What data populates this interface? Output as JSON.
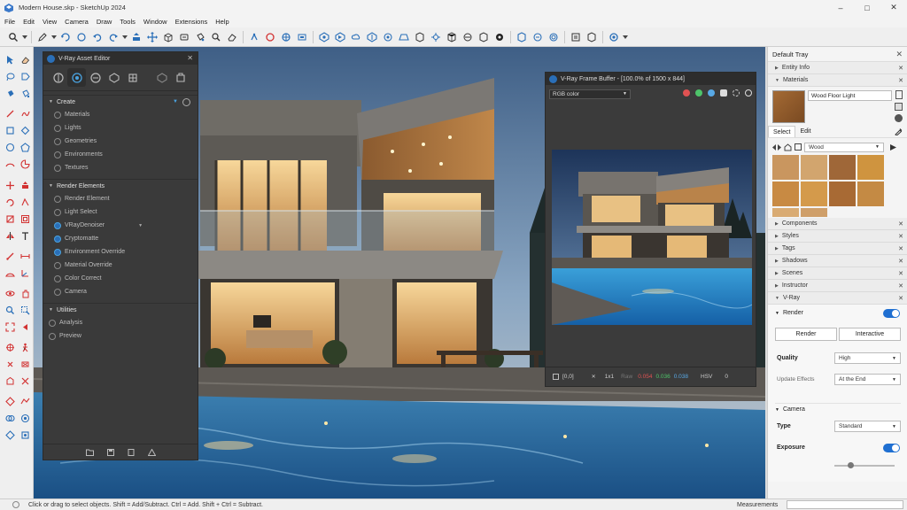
{
  "window": {
    "title": "Modern House.skp - SketchUp 2024"
  },
  "menu": [
    "File",
    "Edit",
    "View",
    "Camera",
    "Draw",
    "Tools",
    "Window",
    "Extensions",
    "Help"
  ],
  "asset_editor": {
    "title": "V-Ray Asset Editor",
    "sections": [
      {
        "label": "Create",
        "items": [
          "Materials",
          "Lights",
          "Geometries",
          "Environments",
          "Textures"
        ]
      },
      {
        "label": "Render Elements",
        "items": [
          "Render Element",
          "Light Select",
          "VRayDenoiser",
          "Cryptomatte",
          "Environment Override",
          "Material Override",
          "Color Correct",
          "Camera"
        ]
      },
      {
        "label": "Utilities",
        "items": [
          "Analysis",
          "Preview"
        ]
      }
    ]
  },
  "frame_buffer": {
    "title": "V-Ray Frame Buffer - [100.0% of 1500 x 844]",
    "channel": "RGB color",
    "coords": "[0,0]",
    "ratio": "1x1",
    "raw_label": "Raw",
    "values": [
      "0.054",
      "0.036",
      "0.038"
    ],
    "mode": "HSV",
    "mode_value": "0"
  },
  "tray": {
    "title": "Default Tray",
    "panels_top": [
      "Entity Info",
      "Materials"
    ],
    "material_name": "Wood Floor Light",
    "tabs": [
      "Select",
      "Edit"
    ],
    "library": "Wood",
    "swatches": [
      "#c9965f",
      "#d2a56e",
      "#9f6738",
      "#cf943f",
      "#c88a43",
      "#d49a4b",
      "#a86a34",
      "#c48a44",
      "#d9ab73",
      "#cf9f69"
    ],
    "panels": [
      "Components",
      "Styles",
      "Tags",
      "Shadows",
      "Scenes",
      "Instructor",
      "V-Ray"
    ],
    "vray": {
      "render_label": "Render",
      "render_button": "Render",
      "interactive_button": "Interactive",
      "quality_label": "Quality",
      "quality_value": "High",
      "update_label": "Update Effects",
      "update_value": "At the End",
      "camera_label": "Camera",
      "type_label": "Type",
      "type_value": "Standard",
      "exposure_label": "Exposure"
    }
  },
  "statusbar": {
    "hint": "Click or drag to select objects. Shift = Add/Subtract. Ctrl = Add. Shift + Ctrl = Subtract.",
    "measurements_label": "Measurements"
  },
  "colors": {
    "accent": "#1f6fd1",
    "toolbar_icon": "#2a6fb8",
    "panel_dark": "#3a3a3a"
  }
}
